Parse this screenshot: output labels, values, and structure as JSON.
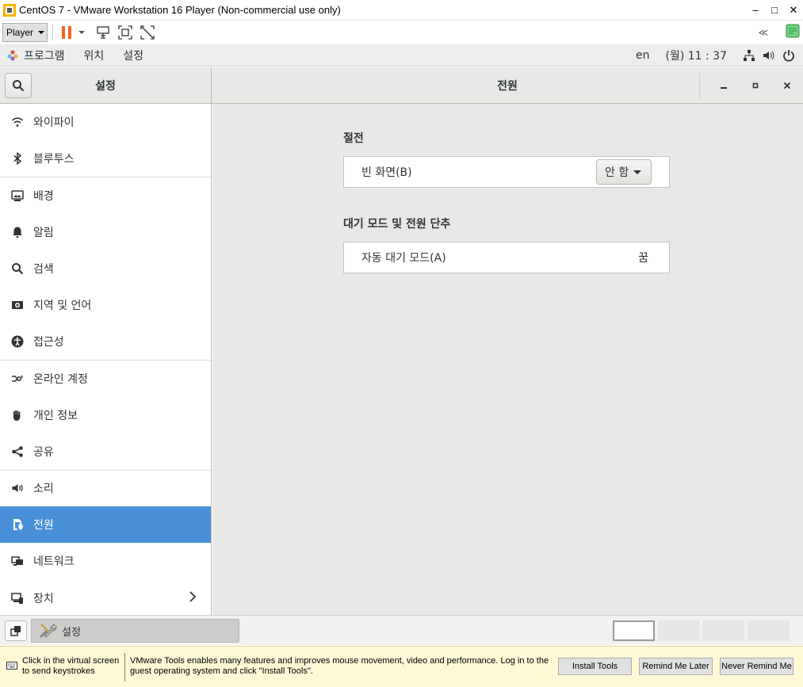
{
  "window": {
    "title": "CentOS 7 - VMware Workstation 16 Player (Non-commercial use only)",
    "minimize": "–",
    "maximize": "□",
    "close": "✕"
  },
  "toolbar": {
    "player_label": "Player"
  },
  "gnome_topbar": {
    "menu": [
      "프로그램",
      "위치",
      "설정"
    ],
    "input_lang": "en",
    "clock": "(월) 11 : 37"
  },
  "settings": {
    "sidebar_title": "설정",
    "panel_title": "전원",
    "sidebar_items": [
      {
        "label": "와이파이",
        "icon": "wifi-icon"
      },
      {
        "label": "블루투스",
        "icon": "bluetooth-icon"
      },
      {
        "label": "배경",
        "icon": "background-icon"
      },
      {
        "label": "알림",
        "icon": "bell-icon"
      },
      {
        "label": "검색",
        "icon": "search-icon"
      },
      {
        "label": "지역 및 언어",
        "icon": "region-icon"
      },
      {
        "label": "접근성",
        "icon": "accessibility-icon"
      },
      {
        "label": "온라인 계정",
        "icon": "online-accounts-icon"
      },
      {
        "label": "개인 정보",
        "icon": "privacy-hand-icon"
      },
      {
        "label": "공유",
        "icon": "share-icon"
      },
      {
        "label": "소리",
        "icon": "speaker-icon"
      },
      {
        "label": "전원",
        "icon": "power-plug-icon",
        "selected": true
      },
      {
        "label": "네트워크",
        "icon": "network-icon"
      },
      {
        "label": "장치",
        "icon": "devices-icon"
      }
    ],
    "power": {
      "section1_title": "절전",
      "blank_screen_label": "빈 화면(B)",
      "blank_screen_value": "안 함",
      "section2_title": "대기 모드 및 전원 단추",
      "auto_suspend_label": "자동 대기 모드(A)",
      "auto_suspend_value": "꿈"
    }
  },
  "taskbar": {
    "task_label": "설정"
  },
  "notification": {
    "hint": "Click in the virtual screen to send keystrokes",
    "message": "VMware Tools enables many features and improves mouse movement, video and performance. Log in to the guest operating system and click \"Install Tools\".",
    "install_label": "Install Tools",
    "remind_label": "Remind Me Later",
    "never_label": "Never Remind Me"
  },
  "colors": {
    "selection": "#4a90d9",
    "pause_orange": "#f26522",
    "notification_bg": "#fdf9d5"
  }
}
